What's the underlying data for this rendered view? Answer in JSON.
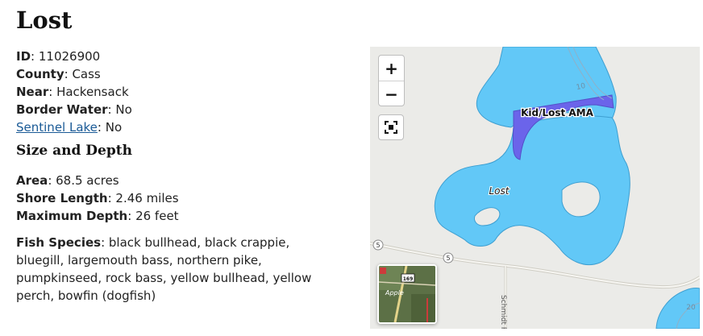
{
  "lake": {
    "name": "Lost",
    "fields": [
      {
        "label": "ID",
        "value": "11026900"
      },
      {
        "label": "County",
        "value": "Cass"
      },
      {
        "label": "Near",
        "value": "Hackensack"
      },
      {
        "label": "Border Water",
        "value": "No"
      },
      {
        "label": "Sentinel Lake",
        "value": "No"
      }
    ]
  },
  "size_depth": {
    "heading": "Size and Depth",
    "area_label": "Area",
    "area_value": "68.5 acres",
    "shore_label": "Shore Length",
    "shore_value": "2.46 miles",
    "depth_label": "Maximum Depth",
    "depth_value": "26 feet"
  },
  "fish": {
    "label": "Fish Species",
    "value": "black bullhead, black crappie, bluegill, largemouth bass, northern pike, pumpkinseed, rock bass, yellow bullhead, yellow perch, bowfin (dogfish)"
  },
  "map": {
    "zoom_in": "+",
    "zoom_out": "−",
    "area_label": "Kid/Lost AMA",
    "lake_label": "Lost",
    "road_shield": "5",
    "road_label": "Schmidt R",
    "contour_10": "10",
    "contour_20": "20",
    "thumb_highway": "169",
    "thumb_place": "Apple",
    "colors": {
      "water": "#62c8f7",
      "ama": "#6b64ea",
      "land": "#ebebe8",
      "road": "#cfcdc4"
    }
  },
  "icons": {
    "fullscreen": "fullscreen-icon"
  }
}
